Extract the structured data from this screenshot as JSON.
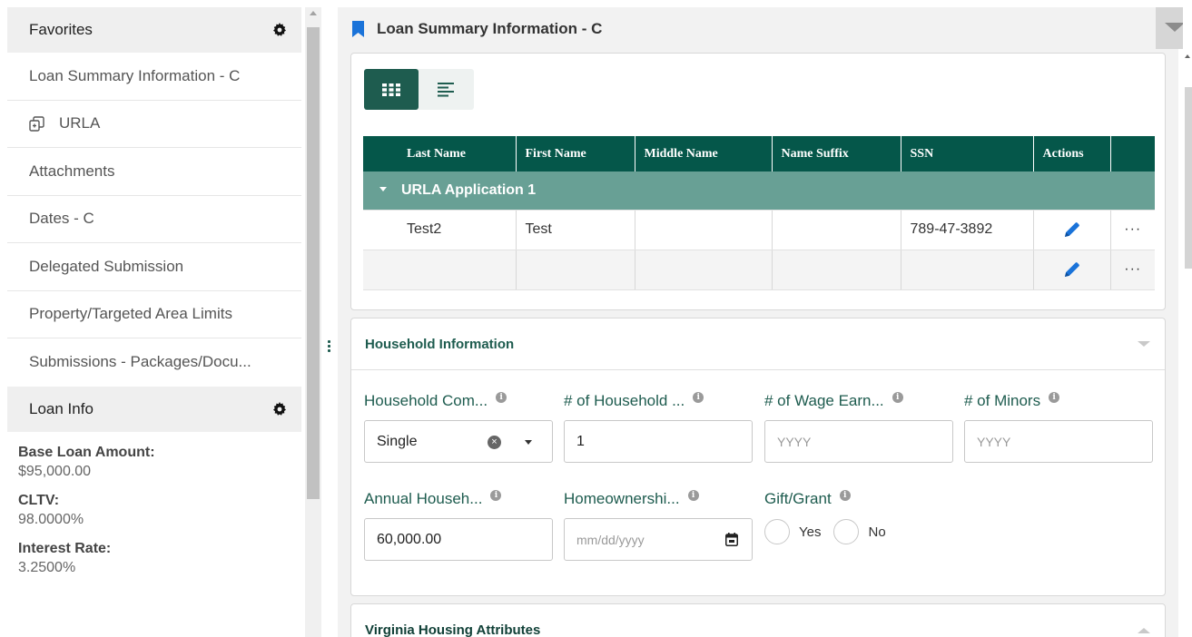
{
  "sidebar": {
    "favorites_title": "Favorites",
    "items": [
      {
        "label": "Loan Summary Information - C"
      },
      {
        "label": "URLA"
      },
      {
        "label": "Attachments"
      },
      {
        "label": "Dates - C"
      },
      {
        "label": "Delegated Submission"
      },
      {
        "label": "Property/Targeted Area Limits"
      },
      {
        "label": "Submissions - Packages/Docu..."
      }
    ],
    "loan_info_title": "Loan Info",
    "loan_info": [
      {
        "label": "Base Loan Amount:",
        "value": "$95,000.00"
      },
      {
        "label": "CLTV:",
        "value": "98.0000%"
      },
      {
        "label": "Interest Rate:",
        "value": "3.2500%"
      }
    ]
  },
  "main": {
    "title": "Loan Summary Information - C",
    "grid": {
      "columns": [
        "Last Name",
        "First Name",
        "Middle Name",
        "Name Suffix",
        "SSN",
        "Actions"
      ],
      "group_label": "URLA Application 1",
      "rows": [
        {
          "last": "Test2",
          "first": "Test",
          "middle": "",
          "suffix": "",
          "ssn": "789-47-3892",
          "more": "···"
        },
        {
          "last": "",
          "first": "",
          "middle": "",
          "suffix": "",
          "ssn": "",
          "more": "···"
        }
      ]
    },
    "household": {
      "title": "Household Information",
      "fields": {
        "composition": {
          "label": "Household Com...",
          "value": "Single"
        },
        "household_size": {
          "label": "# of Household ...",
          "value": "1"
        },
        "wage_earners": {
          "label": "# of Wage Earn...",
          "placeholder": "YYYY"
        },
        "minors": {
          "label": "# of Minors",
          "placeholder": "YYYY"
        },
        "annual_income": {
          "label": "Annual Househ...",
          "value": "60,000.00"
        },
        "homeownership": {
          "label": "Homeownershi...",
          "placeholder": "mm/dd/yyyy"
        },
        "gift_grant": {
          "label": "Gift/Grant",
          "yes": "Yes",
          "no": "No"
        }
      }
    },
    "virginia": {
      "title": "Virginia Housing Attributes"
    }
  },
  "colors": {
    "primary": "#05574a",
    "group_row": "#68a095",
    "accent_blue": "#1a73d9",
    "label_green": "#1e5c4f"
  },
  "icons": [
    "gear-icon",
    "copy-icon",
    "bookmark-icon",
    "grid-view-icon",
    "list-view-icon",
    "pencil-icon",
    "info-icon",
    "calendar-icon",
    "clear-icon"
  ]
}
